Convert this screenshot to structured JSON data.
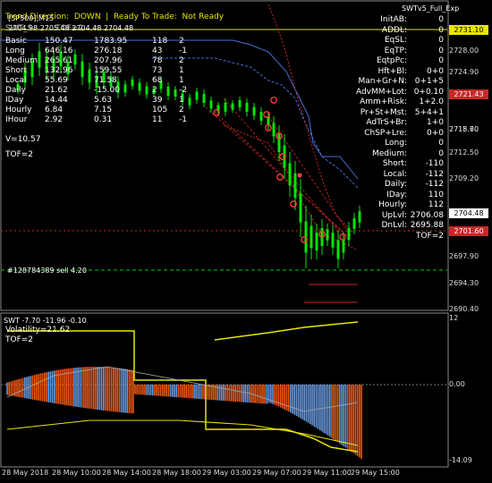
{
  "header": {
    "symbol": "[SP500],M15",
    "ohlc": "2704.98 2705.48 2704.48 2704.48",
    "indicator_name": "SWTv5_Full_Exp",
    "trend_line": "Trend Direction:  DOWN  |  Ready To Trade:  Not Ready"
  },
  "left_stats": {
    "header_row": "SWT_S...   ...TOF=2",
    "rows": [
      {
        "label": "Basic",
        "a": "150.47",
        "b": "1783.95",
        "c": "118",
        "d": "2"
      },
      {
        "label": "Long",
        "a": "646.16",
        "b": "276.18",
        "c": "43",
        "d": "-1"
      },
      {
        "label": "Medium",
        "a": "265.61",
        "b": "207.96",
        "c": "78",
        "d": "2"
      },
      {
        "label": "Short",
        "a": "132.96",
        "b": "159.55",
        "c": "73",
        "d": "1"
      },
      {
        "label": "Local",
        "a": "55.69",
        "b": "71.58",
        "c": "68",
        "d": "1"
      },
      {
        "label": "Daily",
        "a": "21.62",
        "b": "-15.00",
        "c": "2",
        "d": "-2"
      },
      {
        "label": "IDay",
        "a": "14.44",
        "b": "5.63",
        "c": "39",
        "d": "1"
      },
      {
        "label": "Hourly",
        "a": "6.84",
        "b": "7.15",
        "c": "105",
        "d": "2"
      },
      {
        "label": "IHour",
        "a": "2.92",
        "b": "0.31",
        "c": "11",
        "d": "-1"
      }
    ],
    "v_line": "V=10.57",
    "tof_line": "TOF=2"
  },
  "right_panel": [
    {
      "label": "InitAB:",
      "value": "0"
    },
    {
      "label": "ADDL:",
      "value": "0"
    },
    {
      "label": "EqSL:",
      "value": "0"
    },
    {
      "label": "EqTP:",
      "value": "0"
    },
    {
      "label": "EqtpPc:",
      "value": "0"
    },
    {
      "label": "Hft+Bl:",
      "value": "0+0"
    },
    {
      "label": "Man+Gr+N:",
      "value": "0+1+5"
    },
    {
      "label": "AdvMM+Lot:",
      "value": "0+0.10"
    },
    {
      "label": "Amm+Risk:",
      "value": "1+2.0"
    },
    {
      "label": "Pr+St+Mst:",
      "value": "5+4+1"
    },
    {
      "label": "AdTrS+Br:",
      "value": "1+0"
    },
    {
      "label": "ChSP+Lre:",
      "value": "0+0"
    },
    {
      "label": "Long:",
      "value": "0"
    },
    {
      "label": "Medium:",
      "value": "0"
    },
    {
      "label": "Short:",
      "value": "-110"
    },
    {
      "label": "Local:",
      "value": "-112"
    },
    {
      "label": "Daily:",
      "value": "-112"
    },
    {
      "label": "IDay:",
      "value": "110"
    },
    {
      "label": "Hourly:",
      "value": "112"
    },
    {
      "label": "UpLvl:",
      "value": "2706.08"
    },
    {
      "label": "DnLvl:",
      "value": "2695.88"
    },
    {
      "label": "",
      "value": "TOF=2"
    }
  ],
  "order_label": "#128784389 sell 4.20",
  "price_axis": [
    "2731.10",
    "2728.00",
    "2724.90",
    "2721.43",
    "2718.70",
    "2715.60",
    "2712.50",
    "2709.20",
    "2704.48",
    "2701.60",
    "2697.90",
    "2694.30",
    "2690.40"
  ],
  "price_tags": {
    "top": "2731.10",
    "mid_red": "2721.43",
    "current": "2704.48",
    "lower_red": "2701.60"
  },
  "sub_panel": {
    "title": "SWT -7.70 -11.96 -0.10",
    "volatility": "Volatility=21.62",
    "tof": "TOF=2",
    "axis_top": "12",
    "axis_zero": "0.00",
    "axis_bottom": "-14.09"
  },
  "time_axis": [
    "28 May 2018",
    "28 May 10:00",
    "28 May 14:00",
    "28 May 18:00",
    "29 May 03:00",
    "29 May 07:00",
    "29 May 11:00",
    "29 May 15:00"
  ],
  "colors": {
    "background": "#000000",
    "candle": "#00e600",
    "band_blue": "#4a6cd4",
    "band_red": "#c82828",
    "hist_blue": "#6a9be0",
    "hist_orange": "#f05a14",
    "yellow": "#e6e600"
  }
}
